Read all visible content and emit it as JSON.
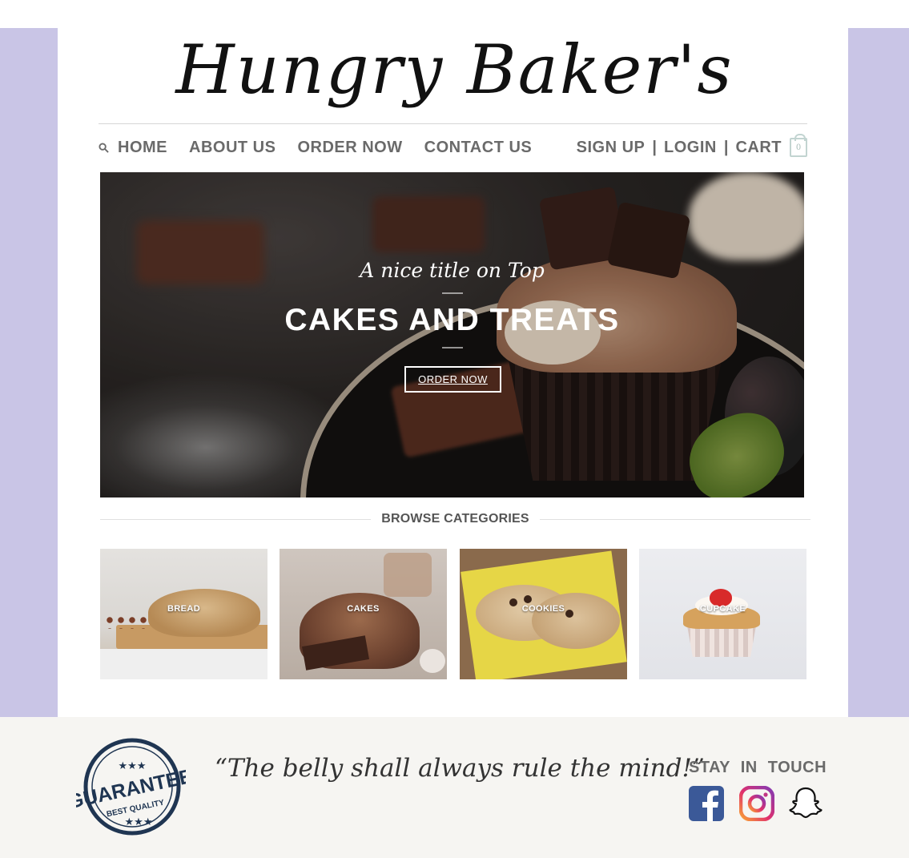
{
  "brand": {
    "logo_text": "Hungry Baker's"
  },
  "nav": {
    "items": [
      {
        "label": "HOME"
      },
      {
        "label": "ABOUT US"
      },
      {
        "label": "ORDER NOW"
      },
      {
        "label": "CONTACT US"
      }
    ],
    "account": {
      "signup": "SIGN UP",
      "separator": "|",
      "login": "LOGIN",
      "cart": "CART",
      "cart_count": "0"
    },
    "search_icon": "search-icon"
  },
  "hero": {
    "kicker": "A nice title on Top",
    "title": "CAKES AND TREATS",
    "button": "ORDER NOW"
  },
  "browse": {
    "heading": "BROWSE CATEGORIES",
    "categories": [
      {
        "label": "BREAD"
      },
      {
        "label": "CAKES"
      },
      {
        "label": "COOKIES"
      },
      {
        "label": "CUPCAKE"
      }
    ]
  },
  "footer": {
    "badge": {
      "main": "GUARANTEE",
      "sub": "BEST QUALITY",
      "stars": "★★★"
    },
    "quote": "“The belly shall always rule the mind!”",
    "stay_in_touch": "STAY IN TOUCH",
    "social": [
      "facebook-icon",
      "instagram-icon",
      "snapchat-icon"
    ]
  },
  "colors": {
    "lavender_side": "#c9c5e6",
    "nav_text": "#6a6a6a",
    "footer_bg": "#f6f5f2",
    "cart_icon": "#c2d4d1",
    "facebook": "#3b5998",
    "stamp": "#1f3552"
  }
}
